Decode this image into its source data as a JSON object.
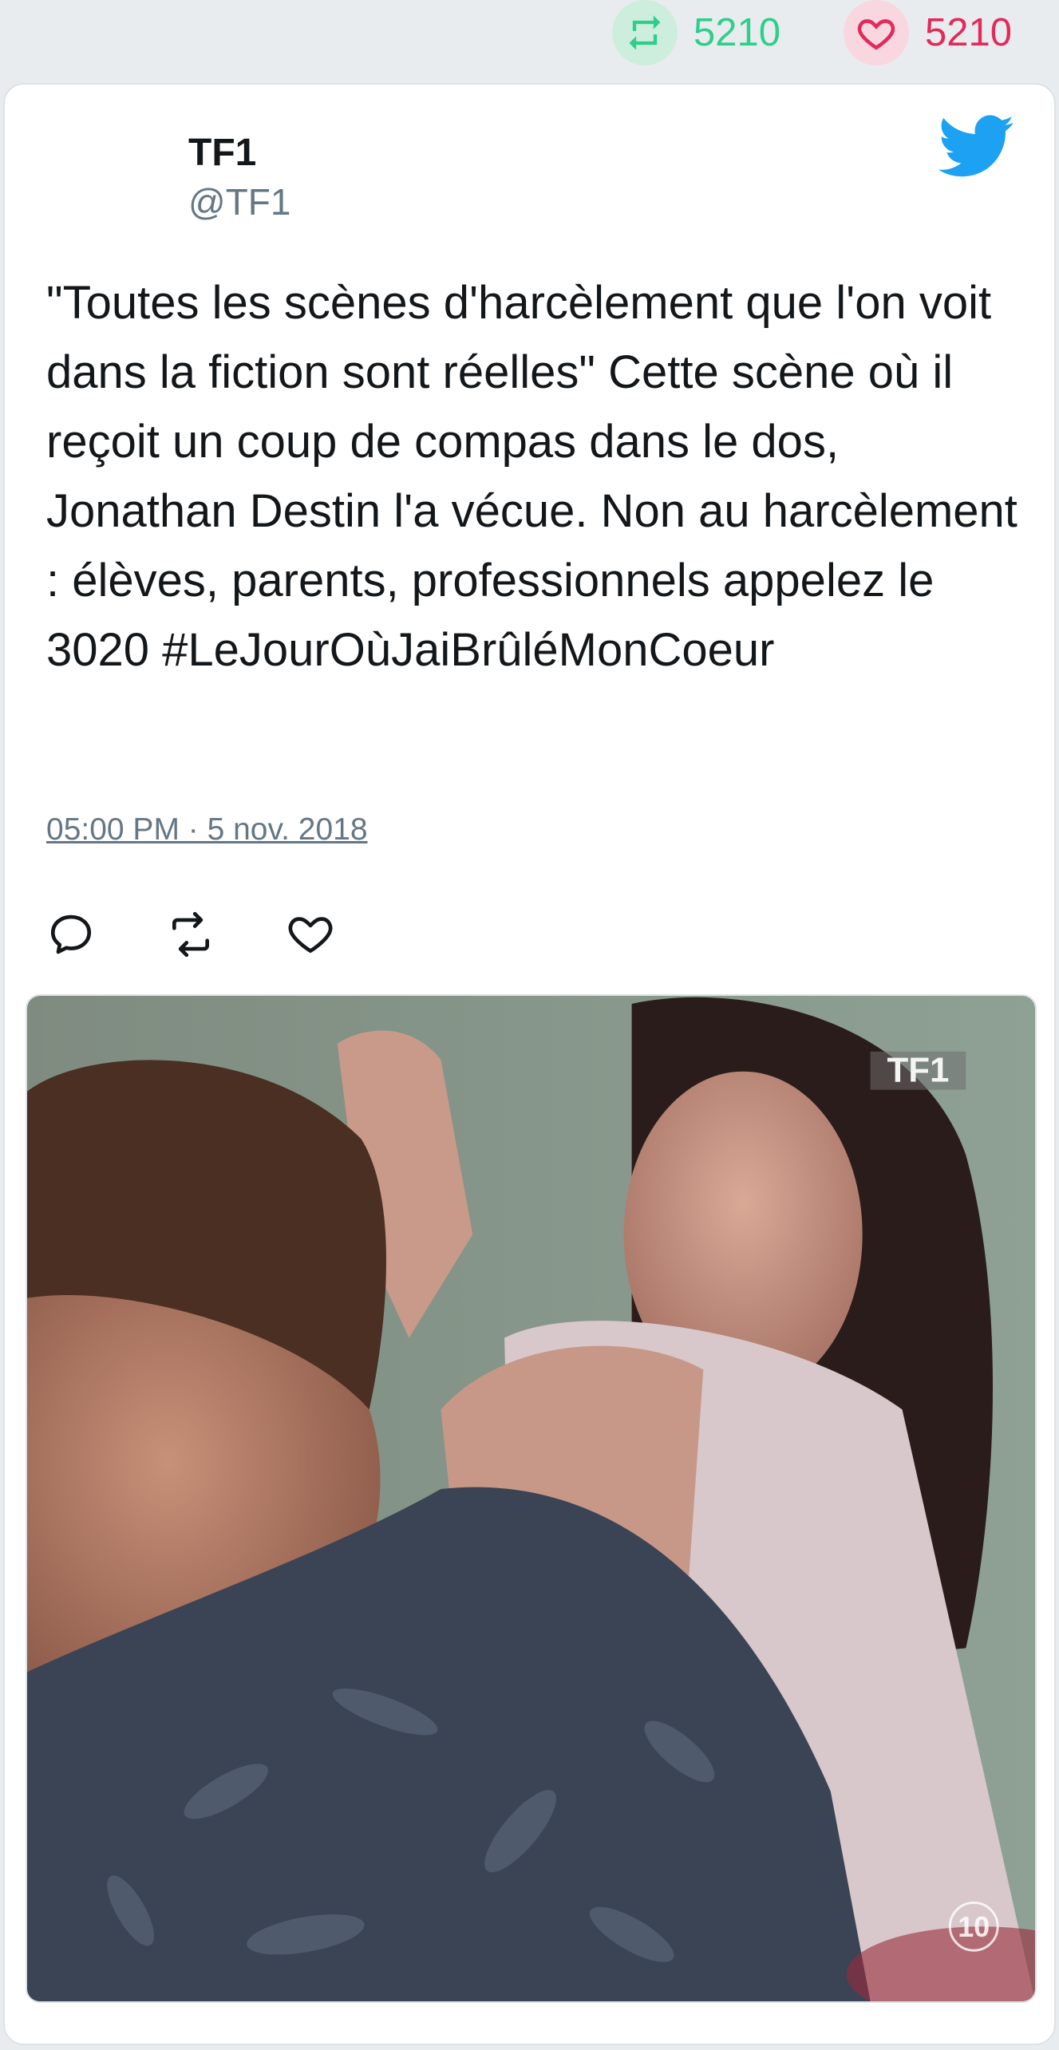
{
  "stats": {
    "retweets": "5210",
    "likes": "5210",
    "retweet_color": "#2ecf8b",
    "like_color": "#e22a5b"
  },
  "author": {
    "name": "TF1",
    "handle": "@TF1"
  },
  "tweet": {
    "text": "\"Toutes les scènes d'harcèlement que l'on voit dans la fiction sont réelles\" Cette scène où il reçoit un coup de compas dans le dos, Jonathan Destin l'a vécue. Non au harcèlement : élèves, parents, professionnels appelez le 3020 #LeJourOùJaiBrûléMonCoeur",
    "timestamp": "05:00 PM · 5 nov. 2018"
  },
  "media": {
    "logo_text": "TF1",
    "channel_badge": "10"
  },
  "icons": {
    "retweet": "retweet-icon",
    "like": "heart-icon",
    "reply": "reply-icon",
    "brand": "twitter-bird-icon"
  },
  "colors": {
    "brand": "#1da1f2",
    "text": "#14171a",
    "muted": "#657786"
  }
}
